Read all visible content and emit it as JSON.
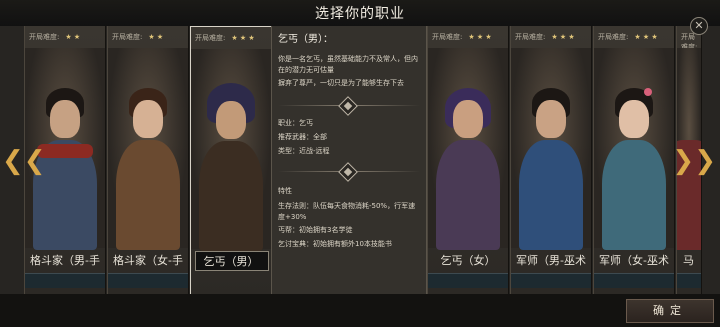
{
  "header": {
    "title": "选择你的职业",
    "close_icon": "close-icon"
  },
  "difficulty_label": "开局难度:",
  "cards": [
    {
      "name": "格斗家（男-手",
      "stars": "★ ★",
      "accent": "#8c2a22"
    },
    {
      "name": "格斗家（女-手",
      "stars": "★ ★",
      "accent": "#7a4a2a"
    },
    {
      "name": "乞丐（男）",
      "stars": "★ ★ ★",
      "accent": "#3b2d22",
      "selected": true
    },
    {
      "name": "乞丐（女）",
      "stars": "★ ★ ★",
      "accent": "#4a3a55"
    },
    {
      "name": "军师（男-巫术",
      "stars": "★ ★ ★",
      "accent": "#2f4f7a"
    },
    {
      "name": "军师（女-巫术",
      "stars": "★ ★ ★",
      "accent": "#3f6a7a"
    },
    {
      "name": "马",
      "stars": "★ ★",
      "accent": "#6a2a2a"
    }
  ],
  "detail": {
    "title": "乞丐（男）：",
    "desc1": "你是一名乞丐，虽然基础能力不及常人，但内在的潜力无可估量",
    "desc2": "摒弃了尊严，一切只是为了能够生存下去",
    "job": "职业：乞丐",
    "weapon": "推荐武器：全部",
    "type": "类型：近战-远程",
    "traits_title": "特性",
    "trait1": "生存法则：队伍每天食物消耗-50%，行军速度+30%",
    "trait2": "丐帮：初始拥有3名学徒",
    "trait3": "乞讨宝典：初始拥有额外10本技能书"
  },
  "nav": {
    "left": "❮❮",
    "right": "❯❯"
  },
  "footer": {
    "confirm": "确定"
  }
}
